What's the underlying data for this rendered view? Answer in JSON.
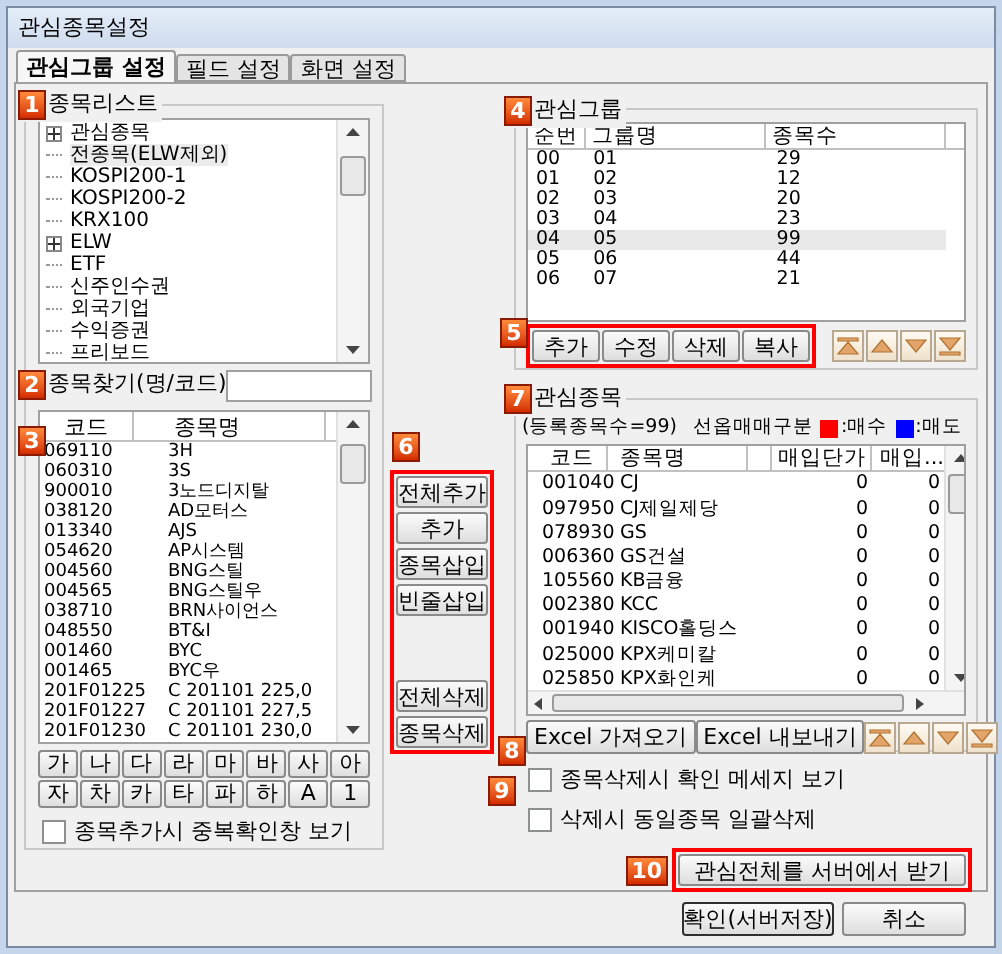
{
  "window": {
    "title": "관심종목설정"
  },
  "tabs": [
    {
      "label": "관심그룹 설정",
      "selected": true
    },
    {
      "label": "필드 설정",
      "selected": false
    },
    {
      "label": "화면 설정",
      "selected": false
    }
  ],
  "stock_list": {
    "badge": "1",
    "title": "종목리스트",
    "tree": [
      {
        "label": "관심종목",
        "expandable": true,
        "selected": false
      },
      {
        "label": "전종목(ELW제외)",
        "expandable": false,
        "selected": true
      },
      {
        "label": "KOSPI200-1",
        "expandable": false,
        "selected": false
      },
      {
        "label": "KOSPI200-2",
        "expandable": false,
        "selected": false
      },
      {
        "label": "KRX100",
        "expandable": false,
        "selected": false
      },
      {
        "label": "ELW",
        "expandable": true,
        "selected": false
      },
      {
        "label": "ETF",
        "expandable": false,
        "selected": false
      },
      {
        "label": "신주인수권",
        "expandable": false,
        "selected": false
      },
      {
        "label": "외국기업",
        "expandable": false,
        "selected": false
      },
      {
        "label": "수익증권",
        "expandable": false,
        "selected": false
      },
      {
        "label": "프리보드",
        "expandable": false,
        "selected": false
      }
    ]
  },
  "search": {
    "badge": "2",
    "label": "종목찾기(명/코드)"
  },
  "stocks": {
    "badge": "3",
    "columns": [
      "코드",
      "종목명"
    ],
    "rows": [
      [
        "069110",
        "3H"
      ],
      [
        "060310",
        "3S"
      ],
      [
        "900010",
        "3노드디지탈"
      ],
      [
        "038120",
        "AD모터스"
      ],
      [
        "013340",
        "AJS"
      ],
      [
        "054620",
        "AP시스템"
      ],
      [
        "004560",
        "BNG스틸"
      ],
      [
        "004565",
        "BNG스틸우"
      ],
      [
        "038710",
        "BRN사이언스"
      ],
      [
        "048550",
        "BT&I"
      ],
      [
        "001460",
        "BYC"
      ],
      [
        "001465",
        "BYC우"
      ],
      [
        "201F01225",
        "C 201101 225,0"
      ],
      [
        "201F01227",
        "C 201101 227,5"
      ],
      [
        "201F01230",
        "C 201101 230,0"
      ]
    ]
  },
  "consonants": [
    "가",
    "나",
    "다",
    "라",
    "마",
    "바",
    "사",
    "아",
    "자",
    "차",
    "카",
    "타",
    "파",
    "하",
    "A",
    "1"
  ],
  "duplicate_check": {
    "label": "종목추가시 중복확인창 보기",
    "checked": false
  },
  "transfer": {
    "badge": "6",
    "top_buttons": [
      "전체추가",
      "추가",
      "종목삽입",
      "빈줄삽입"
    ],
    "bottom_buttons": [
      "전체삭제",
      "종목삭제"
    ]
  },
  "groups": {
    "badge": "4",
    "title": "관심그룹",
    "columns": [
      "순번",
      "그룹명",
      "종목수"
    ],
    "rows": [
      {
        "cells": [
          "00",
          "01",
          "29"
        ],
        "selected": false
      },
      {
        "cells": [
          "01",
          "02",
          "12"
        ],
        "selected": false
      },
      {
        "cells": [
          "02",
          "03",
          "20"
        ],
        "selected": false
      },
      {
        "cells": [
          "03",
          "04",
          "23"
        ],
        "selected": false
      },
      {
        "cells": [
          "04",
          "05",
          "99"
        ],
        "selected": true
      },
      {
        "cells": [
          "05",
          "06",
          "44"
        ],
        "selected": false
      },
      {
        "cells": [
          "06",
          "07",
          "21"
        ],
        "selected": false
      }
    ]
  },
  "group_buttons": {
    "badge": "5",
    "buttons": [
      "추가",
      "수정",
      "삭제",
      "복사"
    ]
  },
  "watchlist": {
    "badge": "7",
    "title": "관심종목",
    "count": "(등록종목수=99)",
    "legend_label": "선옵매매구분",
    "legend": [
      {
        "color": "#ff0000",
        "label": ":매수"
      },
      {
        "color": "#0000ff",
        "label": ":매도"
      }
    ],
    "columns": [
      "코드",
      "종목명",
      "매입단가",
      "매입..."
    ],
    "rows": [
      [
        "001040",
        "CJ",
        "0",
        "0"
      ],
      [
        "097950",
        "CJ제일제당",
        "0",
        "0"
      ],
      [
        "078930",
        "GS",
        "0",
        "0"
      ],
      [
        "006360",
        "GS건설",
        "0",
        "0"
      ],
      [
        "105560",
        "KB금융",
        "0",
        "0"
      ],
      [
        "002380",
        "KCC",
        "0",
        "0"
      ],
      [
        "001940",
        "KISCO홀딩스",
        "0",
        "0"
      ],
      [
        "025000",
        "KPX케미칼",
        "0",
        "0"
      ],
      [
        "025850",
        "KPX화인케",
        "0",
        "0"
      ]
    ]
  },
  "excel": {
    "badge": "8",
    "buttons": [
      "Excel 가져오기",
      "Excel 내보내기"
    ]
  },
  "options": {
    "badge": "9",
    "checkboxes": [
      {
        "label": "종목삭제시 확인 메세지 보기",
        "checked": false
      },
      {
        "label": "삭제시 동일종목 일괄삭제",
        "checked": false
      }
    ]
  },
  "server": {
    "badge": "10",
    "label": "관심전체를 서버에서 받기"
  },
  "footer": {
    "buttons": [
      "확인(서버저장)",
      "취소"
    ]
  }
}
